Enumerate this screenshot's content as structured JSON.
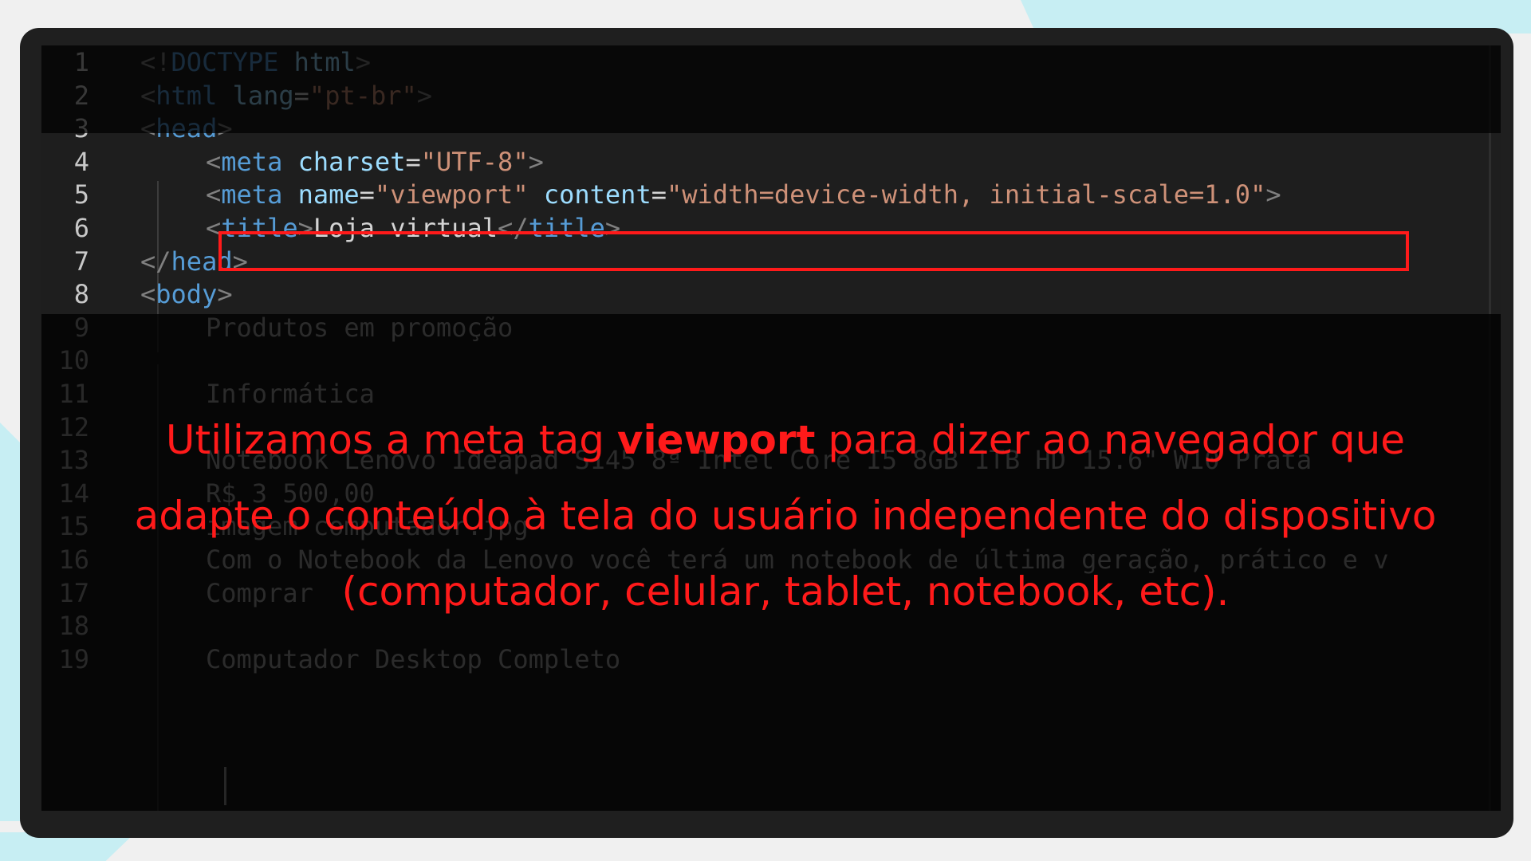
{
  "code_lines": [
    {
      "n": "1",
      "parts": [
        [
          "bracket",
          "<!"
        ],
        [
          "tag",
          "DOCTYPE"
        ],
        [
          "text",
          " "
        ],
        [
          "attr",
          "html"
        ],
        [
          "bracket",
          ">"
        ]
      ]
    },
    {
      "n": "2",
      "parts": [
        [
          "bracket",
          "<"
        ],
        [
          "tag",
          "html"
        ],
        [
          "text",
          " "
        ],
        [
          "attr",
          "lang"
        ],
        [
          "eq",
          "="
        ],
        [
          "str",
          "\"pt-br\""
        ],
        [
          "bracket",
          ">"
        ]
      ]
    },
    {
      "n": "3",
      "parts": [
        [
          "bracket",
          "<"
        ],
        [
          "tag",
          "head"
        ],
        [
          "bracket",
          ">"
        ]
      ]
    },
    {
      "n": "4",
      "parts": [
        [
          "bracket",
          "<"
        ],
        [
          "tag",
          "meta"
        ],
        [
          "text",
          " "
        ],
        [
          "attr",
          "charset"
        ],
        [
          "eq",
          "="
        ],
        [
          "str",
          "\"UTF-8\""
        ],
        [
          "bracket",
          ">"
        ]
      ]
    },
    {
      "n": "5",
      "parts": [
        [
          "bracket",
          "<"
        ],
        [
          "tag",
          "meta"
        ],
        [
          "text",
          " "
        ],
        [
          "attr",
          "name"
        ],
        [
          "eq",
          "="
        ],
        [
          "str",
          "\"viewport\""
        ],
        [
          "text",
          " "
        ],
        [
          "attr",
          "content"
        ],
        [
          "eq",
          "="
        ],
        [
          "str",
          "\"width=device-width, initial-scale=1.0\""
        ],
        [
          "bracket",
          ">"
        ]
      ]
    },
    {
      "n": "6",
      "parts": [
        [
          "bracket",
          "<"
        ],
        [
          "tag",
          "title"
        ],
        [
          "bracket",
          ">"
        ],
        [
          "text",
          "Loja virtual"
        ],
        [
          "bracket",
          "</"
        ],
        [
          "tag",
          "title"
        ],
        [
          "bracket",
          ">"
        ]
      ]
    },
    {
      "n": "7",
      "parts": [
        [
          "bracket",
          "</"
        ],
        [
          "tag",
          "head"
        ],
        [
          "bracket",
          ">"
        ]
      ]
    },
    {
      "n": "8",
      "parts": [
        [
          "bracket",
          "<"
        ],
        [
          "tag",
          "body"
        ],
        [
          "bracket",
          ">"
        ]
      ]
    },
    {
      "n": "9",
      "parts": [
        [
          "text",
          "Produtos em promoção"
        ]
      ]
    },
    {
      "n": "10",
      "parts": []
    },
    {
      "n": "11",
      "parts": [
        [
          "text",
          "Informática"
        ]
      ]
    },
    {
      "n": "12",
      "parts": []
    },
    {
      "n": "13",
      "parts": [
        [
          "text",
          "Notebook Lenovo Ideapad S145 8ª Intel Core I5 8GB 1TB HD 15.6\" W10 Prata"
        ]
      ]
    },
    {
      "n": "14",
      "parts": [
        [
          "text",
          "R$ 3 500,00"
        ]
      ]
    },
    {
      "n": "15",
      "parts": [
        [
          "text",
          "imagem computador.jpg"
        ]
      ]
    },
    {
      "n": "16",
      "parts": [
        [
          "text",
          "Com o Notebook da Lenovo você terá um notebook de última geração, prático e v"
        ]
      ]
    },
    {
      "n": "17",
      "parts": [
        [
          "text",
          "Comprar"
        ]
      ]
    },
    {
      "n": "18",
      "parts": []
    },
    {
      "n": "19",
      "parts": [
        [
          "text",
          "Computador Desktop Completo"
        ]
      ]
    }
  ],
  "caption": {
    "before": "Utilizamos a meta tag ",
    "bold": "viewport",
    "after": " para dizer ao navegador que adapte o conteúdo à tela do usuário independente do dispositivo (computador, celular, tablet, notebook, etc)."
  },
  "colors": {
    "highlight": "#ff1a1a",
    "tag": "#569cd6",
    "attr": "#9cdcfe",
    "string": "#ce9178"
  }
}
